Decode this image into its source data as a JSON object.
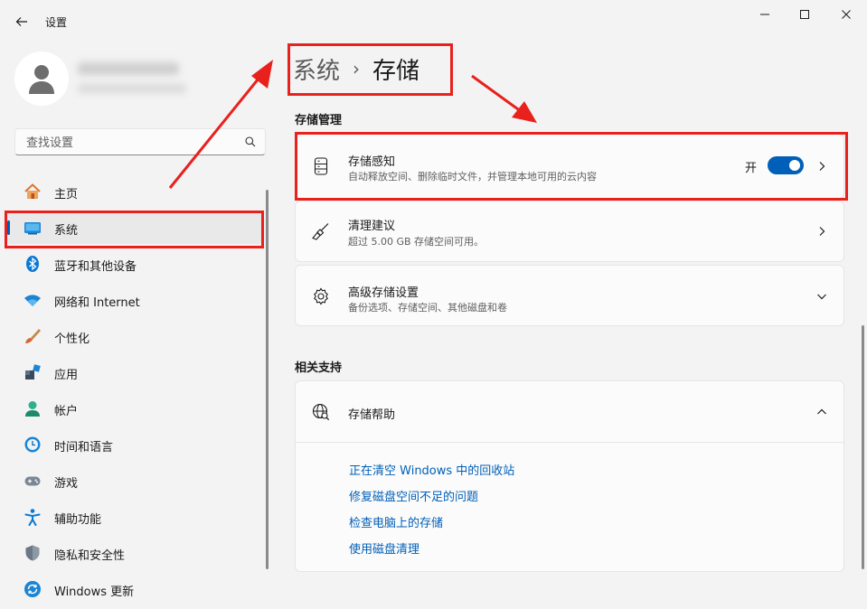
{
  "app": {
    "title": "设置"
  },
  "window_controls": {
    "minimize": "—",
    "maximize": "☐",
    "close": "✕"
  },
  "search": {
    "placeholder": "查找设置"
  },
  "sidebar": {
    "items": [
      {
        "label": "主页",
        "icon": "home-icon"
      },
      {
        "label": "系统",
        "icon": "system-icon",
        "active": true
      },
      {
        "label": "蓝牙和其他设备",
        "icon": "bluetooth-icon"
      },
      {
        "label": "网络和 Internet",
        "icon": "wifi-icon"
      },
      {
        "label": "个性化",
        "icon": "brush-icon"
      },
      {
        "label": "应用",
        "icon": "apps-icon"
      },
      {
        "label": "帐户",
        "icon": "account-icon"
      },
      {
        "label": "时间和语言",
        "icon": "time-language-icon"
      },
      {
        "label": "游戏",
        "icon": "gaming-icon"
      },
      {
        "label": "辅助功能",
        "icon": "accessibility-icon"
      },
      {
        "label": "隐私和安全性",
        "icon": "shield-icon"
      },
      {
        "label": "Windows 更新",
        "icon": "update-icon"
      }
    ]
  },
  "breadcrumb": {
    "parent": "系统",
    "separator": "›",
    "current": "存储"
  },
  "storage_management": {
    "title": "存储管理",
    "storage_sense": {
      "title": "存储感知",
      "subtitle": "自动释放空间、删除临时文件，并管理本地可用的云内容",
      "toggle_label": "开",
      "enabled": true
    },
    "cleanup": {
      "title": "清理建议",
      "subtitle": "超过 5.00 GB 存储空间可用。"
    },
    "advanced": {
      "title": "高级存储设置",
      "subtitle": "备份选项、存储空间、其他磁盘和卷"
    }
  },
  "related_support": {
    "title": "相关支持",
    "help": {
      "title": "存储帮助",
      "links": [
        "正在清空 Windows 中的回收站",
        "修复磁盘空间不足的问题",
        "检查电脑上的存储",
        "使用磁盘清理"
      ]
    }
  },
  "colors": {
    "accent": "#005fb8",
    "highlight": "#e8211d",
    "background": "#f3f3f3",
    "card": "#fbfbfb"
  }
}
